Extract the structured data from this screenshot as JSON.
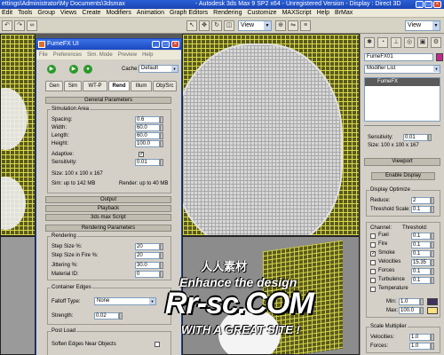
{
  "titlebar": {
    "title_left": "ettings\\Administrator\\My Documents\\3dsmax",
    "title_right": "- Autodesk 3ds Max 9 SP2 x64 - Unregistered Version - Display : Direct 3D"
  },
  "menubar": [
    "Edit",
    "Tools",
    "Group",
    "Views",
    "Create",
    "Modifiers",
    "Animation",
    "Graph Editors",
    "Rendering",
    "Customize",
    "MAXScript",
    "Help",
    "BrMax"
  ],
  "toolbar": {
    "view_select": "View",
    "view_select_right": "View"
  },
  "dialog": {
    "title": "FumeFX UI",
    "menu": [
      "File",
      "Preferences",
      "Sim. Mode",
      "Preview",
      "Help"
    ],
    "cache_label": "Cache:",
    "cache_value": "Default",
    "tabs": [
      "Gen",
      "Sim",
      "WT-P",
      "Rend",
      "Illum",
      "Obj/Src"
    ],
    "rollout_general": "General Parameters",
    "group_sim_area": "Simulation Area",
    "spacing_label": "Spacing:",
    "spacing_value": "0.6",
    "width_label": "Width:",
    "width_value": "60.0",
    "length_label": "Length:",
    "length_value": "60.0",
    "height_label": "Height:",
    "height_value": "100.0",
    "adaptive_label": "Adaptive:",
    "sensitivity_label": "Sensitivity:",
    "sensitivity_value": "0.01",
    "size_text": "Size: 100 x 100 x 167",
    "sim_text": "Sim: up to 142 MB",
    "render_text": "Render: up to 40 MB",
    "rollout_output": "Output",
    "rollout_playback": "Playback",
    "rollout_script": "3ds max Script",
    "rollout_render": "Rendering Parameters",
    "group_rendering": "Rendering",
    "step_size_label": "Step Size %:",
    "step_size_value": "20",
    "step_fire_label": "Step Size in Fire %:",
    "step_fire_value": "20",
    "jittering_label": "Jittering %:",
    "jittering_value": "30.0",
    "material_label": "Material ID:",
    "material_value": "0",
    "group_contact": "Container Edges",
    "falloff_label": "Falloff Type:",
    "falloff_value": "None",
    "strength_label": "Strength:",
    "strength_value": "0.02",
    "group_postload": "Post Load",
    "soften_label": "Soften Edges Near Objects"
  },
  "panel": {
    "object_name": "FumeFX01",
    "modifier_list": "Modifier List",
    "stack_item": "FumeFX",
    "sensitivity_label": "Sensitivity:",
    "sensitivity_value": "0.01",
    "size_text": "Size: 100 x 100 x 167",
    "viewport_rollout": "Viewport",
    "enable_display": "Enable Display",
    "display_optimize": "Display Optimize",
    "reduce_label": "Reduce:",
    "reduce_value": "2",
    "threshold_label": "Threshold Scale:",
    "threshold_value": "0.1",
    "channel_label": "Channel:",
    "threshold_head": "Threshold:",
    "channels": [
      {
        "name": "Fuel",
        "value": "0.1",
        "checked": false
      },
      {
        "name": "Fire",
        "value": "0.1",
        "checked": false
      },
      {
        "name": "Smoke",
        "value": "0.1",
        "checked": true
      },
      {
        "name": "Velocities",
        "value": "15.35",
        "checked": false
      },
      {
        "name": "Forces",
        "value": "0.1",
        "checked": false
      },
      {
        "name": "Turbulence",
        "value": "0.1",
        "checked": false
      },
      {
        "name": "Temperature",
        "value": "",
        "checked": false
      }
    ],
    "min_label": "Min:",
    "min_value": "1.0",
    "max_label": "Max:",
    "max_value": "100.0",
    "scale_multiplier": "Scale Multiplier",
    "velocities_label": "Velocities:",
    "velocities_value": "1.0",
    "forces_label": "Forces:",
    "forces_value": "1.0"
  },
  "watermark": {
    "line1": "人人素材",
    "line2": "Enhance the design",
    "line3": "Rr-sc.COM",
    "line4": "WITH A GREAT SITE !"
  },
  "colors": {
    "title_blue": "#1b45b3",
    "grid_yellow": "#d8d84a",
    "panel_gray": "#d4d0c8",
    "max_color": "#ffe080",
    "min_color": "#403060"
  }
}
